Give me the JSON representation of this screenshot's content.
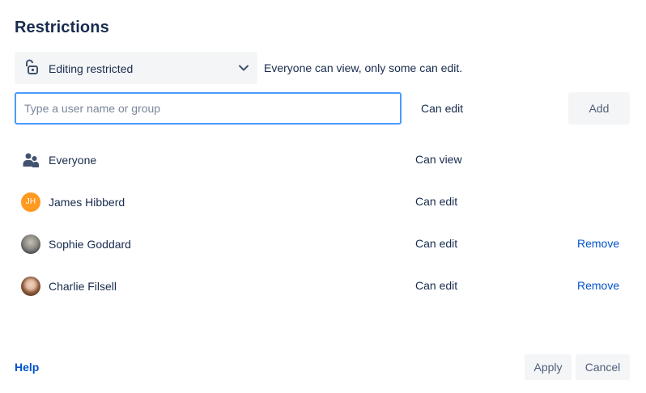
{
  "dialog": {
    "title": "Restrictions"
  },
  "restriction": {
    "selected": "Editing restricted",
    "description": "Everyone can view, only some can edit.",
    "icon": "unlock-icon"
  },
  "add_user": {
    "input_value": "",
    "placeholder": "Type a user name or group",
    "permission": "Can edit",
    "add_label": "Add"
  },
  "entries": [
    {
      "name": "Everyone",
      "permission": "Can view",
      "remove": "",
      "icon": "people-icon"
    },
    {
      "name": "James Hibberd",
      "permission": "Can edit",
      "remove": "",
      "initials": "JH",
      "avatar_color": "#ff991f"
    },
    {
      "name": "Sophie Goddard",
      "permission": "Can edit",
      "remove": "Remove"
    },
    {
      "name": "Charlie Filsell",
      "permission": "Can edit",
      "remove": "Remove"
    }
  ],
  "footer": {
    "help": "Help",
    "apply": "Apply",
    "cancel": "Cancel"
  },
  "colors": {
    "link": "#0052cc",
    "input_focus": "#4c9aff",
    "button_bg": "#f4f5f7",
    "text": "#172b4d"
  }
}
